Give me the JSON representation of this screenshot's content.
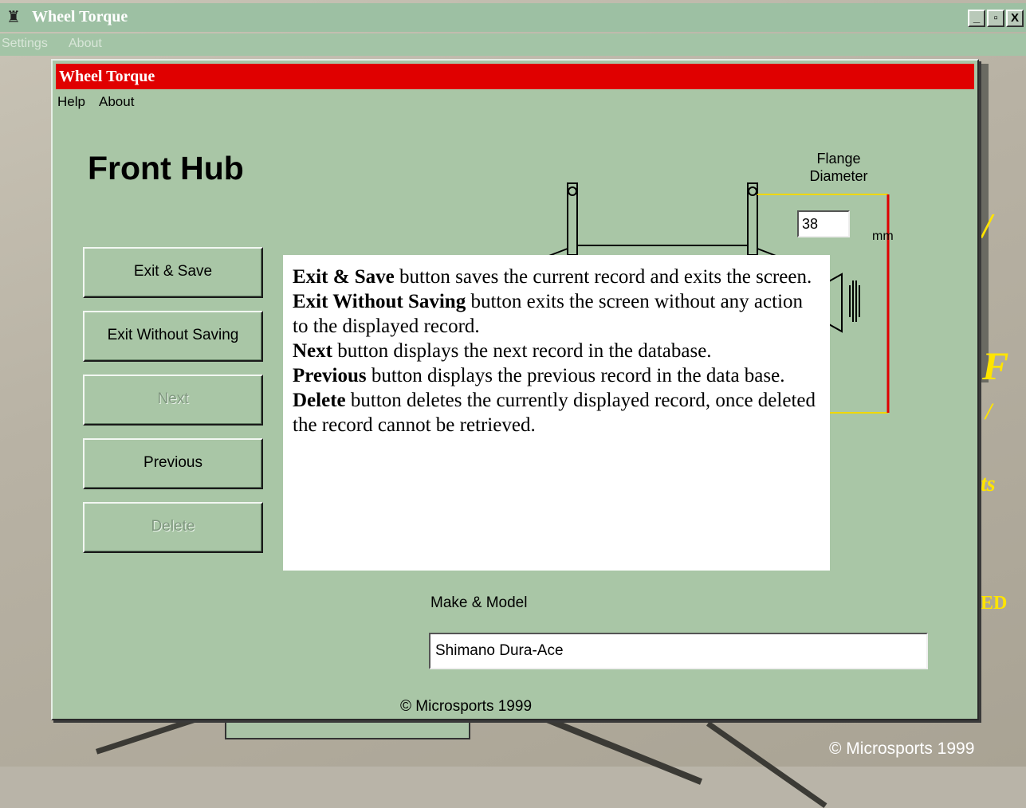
{
  "outer_window": {
    "title": "Wheel Torque",
    "menu": [
      "Settings",
      "About"
    ],
    "controls": {
      "minimize": "_",
      "maximize": "▫",
      "close": "X"
    },
    "footer_copyright": "© Microsports 1999",
    "background_fragments": [
      "ts",
      "ED"
    ]
  },
  "dialog": {
    "title": "Wheel Torque",
    "title_bar_color": "#e00000",
    "menu": [
      "Help",
      "About"
    ],
    "heading": "Front Hub",
    "buttons": [
      {
        "label": "Exit & Save",
        "enabled": true
      },
      {
        "label": "Exit Without Saving",
        "enabled": true
      },
      {
        "label": "Next",
        "enabled": false
      },
      {
        "label": "Previous",
        "enabled": true
      },
      {
        "label": "Delete",
        "enabled": false
      }
    ],
    "flange": {
      "label_line1": "Flange",
      "label_line2": "Diameter",
      "value": "38",
      "unit": "mm"
    },
    "make_model": {
      "label": "Make & Model",
      "value": "Shimano Dura-Ace"
    },
    "copyright": "© Microsports 1999"
  },
  "help_overlay": [
    {
      "term": "Exit & Save",
      "text": " button saves the current record and exits the screen."
    },
    {
      "term": "Exit Without Saving",
      "text": " button exits the screen without any action to the displayed record."
    },
    {
      "term": "Next",
      "text": " button displays the next record in the database."
    },
    {
      "term": "Previous",
      "text": " button displays the previous record in the data base."
    },
    {
      "term": "Delete",
      "text": " button deletes the currently displayed record, once deleted the record cannot be retrieved."
    }
  ]
}
